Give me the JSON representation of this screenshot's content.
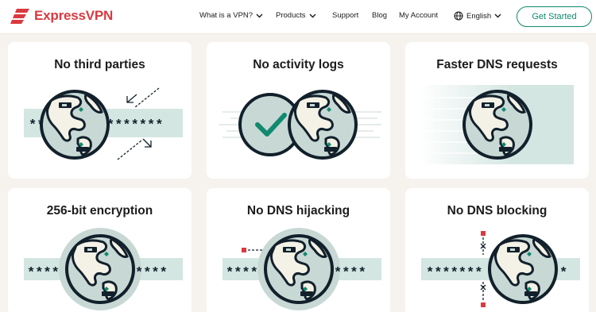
{
  "nav": {
    "brand": "ExpressVPN",
    "items": [
      {
        "label": "What is a VPN?"
      },
      {
        "label": "Products"
      },
      {
        "label": "Support"
      },
      {
        "label": "Blog"
      },
      {
        "label": "My Account"
      }
    ],
    "language": "English",
    "cta": "Get Started"
  },
  "cards": [
    {
      "title": "No third parties",
      "left_stars": "**",
      "right_stars": "*******"
    },
    {
      "title": "No activity logs"
    },
    {
      "title": "Faster DNS requests"
    },
    {
      "title": "256-bit encryption",
      "left_stars": "****",
      "right_stars": "****"
    },
    {
      "title": "No DNS hijacking",
      "left_stars": "****",
      "right_stars": "****"
    },
    {
      "title": "No DNS blocking",
      "left_stars": "*******",
      "right_stars": "*"
    }
  ],
  "colors": {
    "brand_red": "#da3940",
    "accent_green": "#0f8a6e",
    "globe_ocean": "#c8d8d5",
    "globe_land": "#f4f1e6",
    "outline": "#12202b",
    "band": "#d4e6e2"
  },
  "icons": [
    "expressvpn-logo-icon",
    "chevron-down-icon",
    "globe-icon",
    "check-icon",
    "arrow-icon",
    "x-mark-icon"
  ]
}
